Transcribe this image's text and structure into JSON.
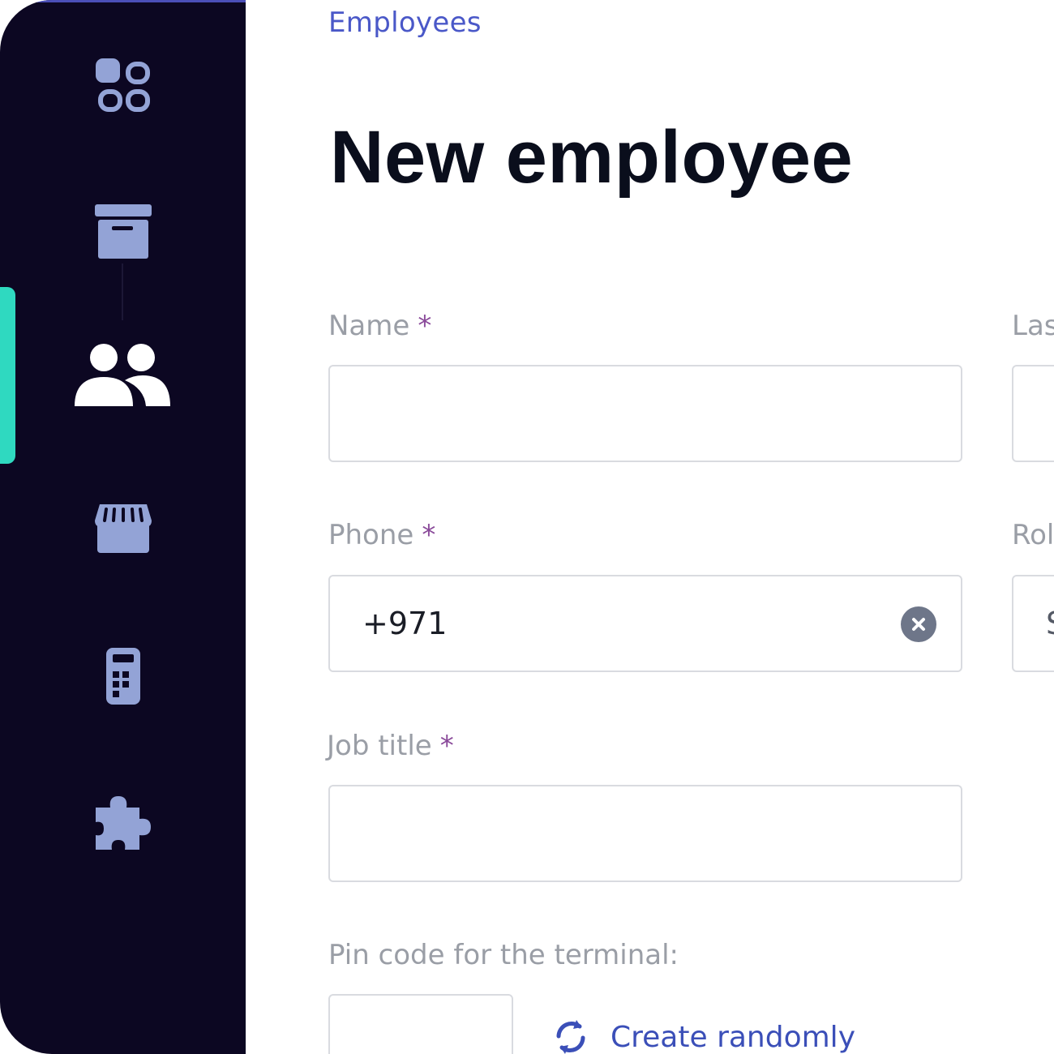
{
  "breadcrumb": "Employees",
  "page_title": "New employee",
  "colors": {
    "sidebar_bg": "#0c0722",
    "icon": "#93a3d6",
    "icon_active": "#ffffff",
    "active_indicator": "#2fd9c0",
    "link": "#3b4fb8",
    "required": "#8a4a9a"
  },
  "sidebar": {
    "items": [
      {
        "icon": "apps-grid-icon",
        "active": false
      },
      {
        "icon": "archive-box-icon",
        "active": false
      },
      {
        "icon": "users-icon",
        "active": true
      },
      {
        "icon": "store-icon",
        "active": false
      },
      {
        "icon": "pos-terminal-icon",
        "active": false
      },
      {
        "icon": "puzzle-piece-icon",
        "active": false
      }
    ]
  },
  "form": {
    "name": {
      "label": "Name",
      "required_mark": "*",
      "value": ""
    },
    "last_name": {
      "label": "Las"
    },
    "phone": {
      "label": "Phone",
      "required_mark": "*",
      "value": "+971"
    },
    "role": {
      "label": "Rol",
      "value": "S"
    },
    "job_title": {
      "label": "Job title",
      "required_mark": "*",
      "value": ""
    },
    "pin_code": {
      "label": "Pin code for the terminal:",
      "value": ""
    },
    "create_randomly": "Create randomly"
  }
}
